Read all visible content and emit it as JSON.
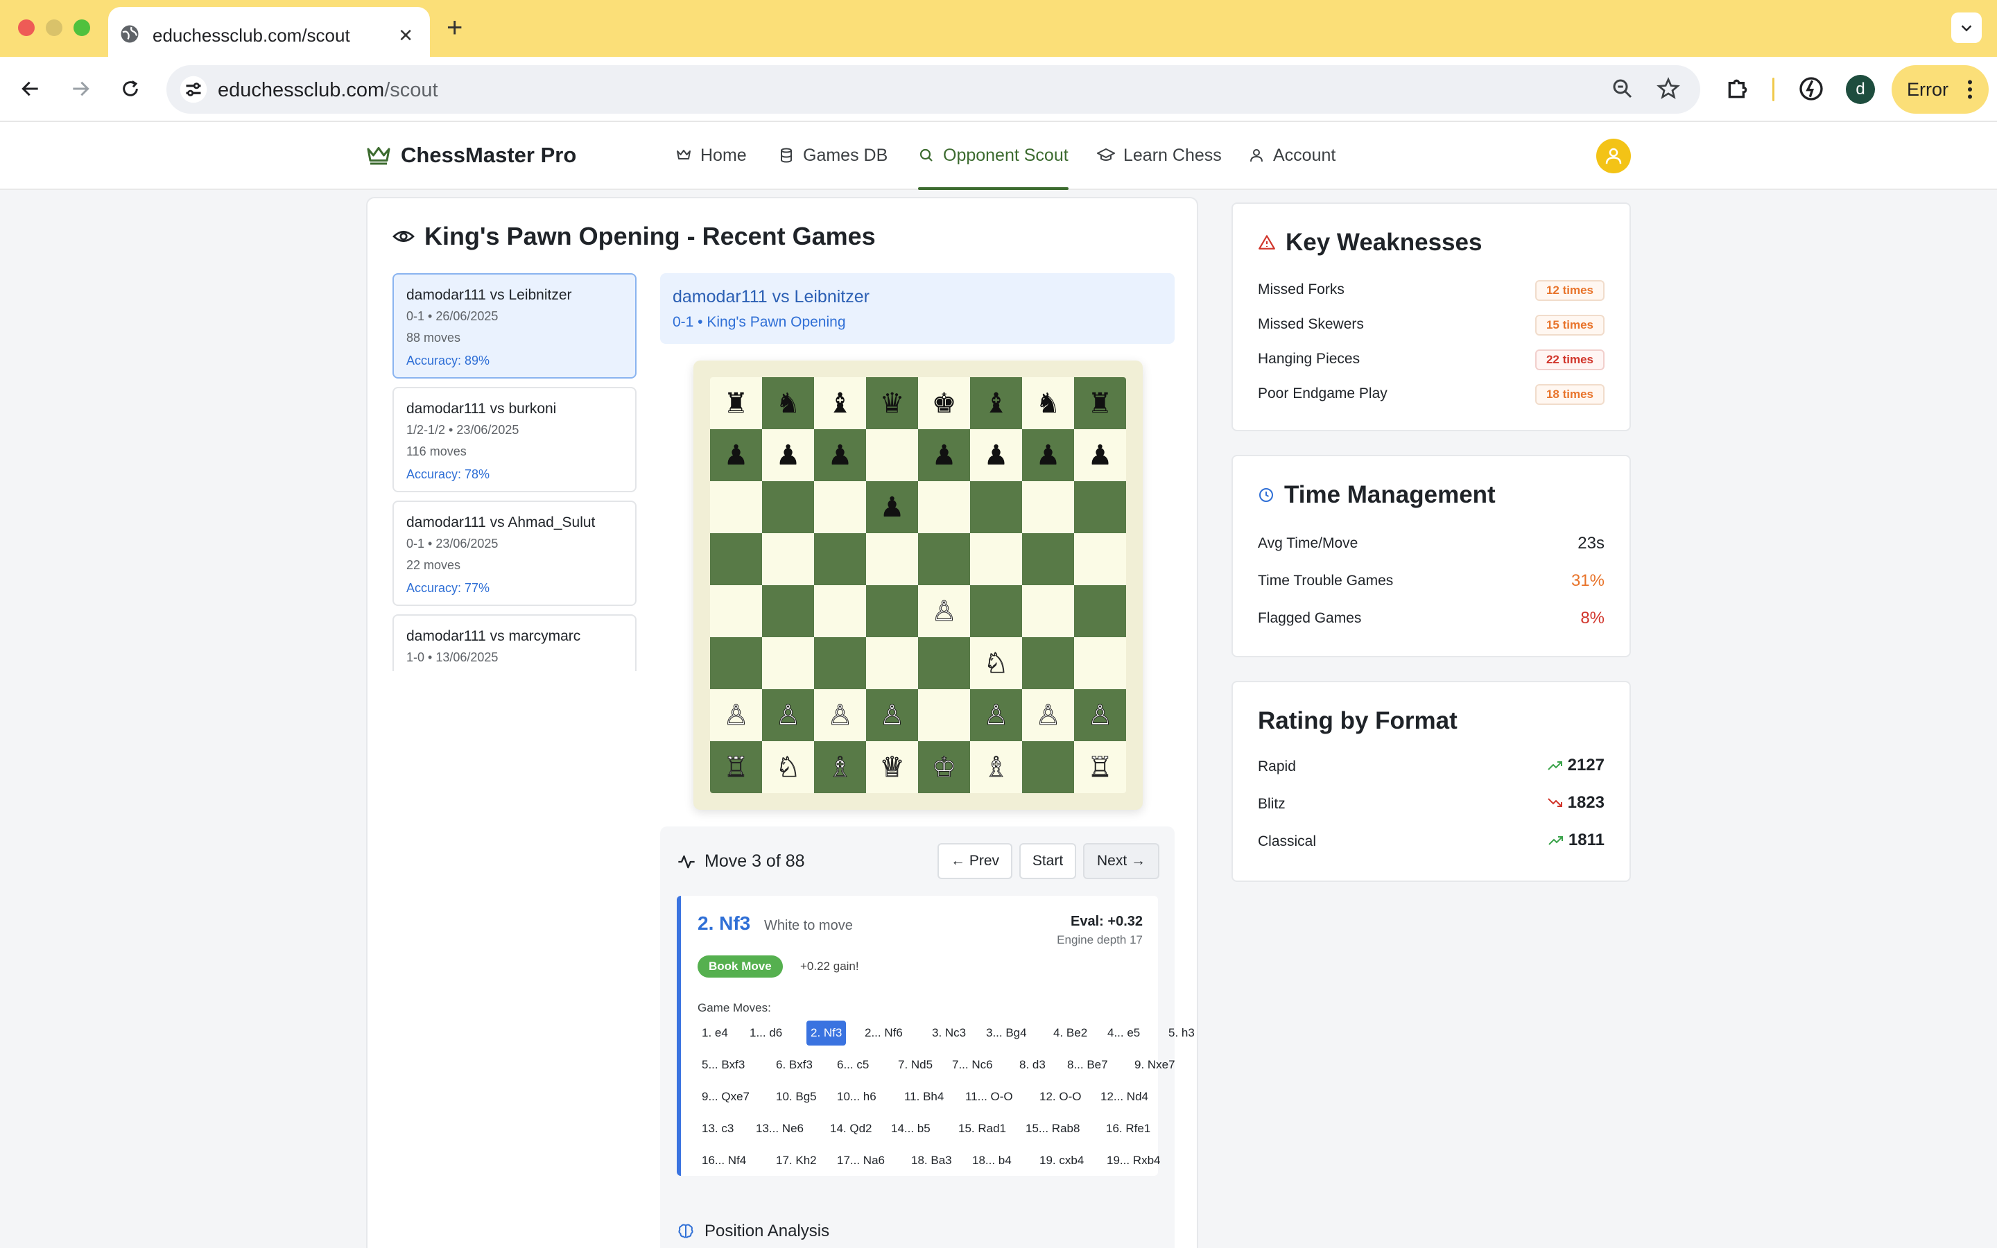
{
  "browser": {
    "tab_title": "educhessclub.com/scout",
    "url_domain": "educhessclub.com",
    "url_path": "/scout",
    "profile_initial": "d",
    "error_label": "Error"
  },
  "app": {
    "brand": "ChessMaster Pro",
    "nav": [
      {
        "label": "Home",
        "icon": "house-icon"
      },
      {
        "label": "Games DB",
        "icon": "database-icon"
      },
      {
        "label": "Opponent Scout",
        "icon": "search-icon",
        "active": true
      },
      {
        "label": "Learn Chess",
        "icon": "graduation-cap-icon"
      },
      {
        "label": "Account",
        "icon": "user-icon"
      }
    ]
  },
  "main": {
    "title": "King's Pawn Opening - Recent Games",
    "games": [
      {
        "title": "damodar111 vs Leibnitzer",
        "meta": "0-1 • 26/06/2025",
        "moves": "88 moves",
        "accuracy": "Accuracy: 89%"
      },
      {
        "title": "damodar111 vs burkoni",
        "meta": "1/2-1/2 • 23/06/2025",
        "moves": "116 moves",
        "accuracy": "Accuracy: 78%"
      },
      {
        "title": "damodar111 vs Ahmad_Sulut",
        "meta": "0-1 • 23/06/2025",
        "moves": "22 moves",
        "accuracy": "Accuracy: 77%"
      },
      {
        "title": "damodar111 vs marcymarc",
        "meta": "1-0 • 13/06/2025",
        "moves": "",
        "accuracy": ""
      }
    ],
    "selected_game": {
      "title": "damodar111 vs Leibnitzer",
      "subtitle": "0-1 • King's Pawn Opening"
    },
    "board": {
      "ranks": [
        "rnbqkbnr",
        "ppp.pppp",
        "...p....",
        "........",
        "....P...",
        ".....N..",
        "PPPP.PPP",
        "RNBQKB.R"
      ]
    },
    "move_panel": {
      "title": "Move 3 of 88",
      "prev": "← Prev",
      "start": "Start",
      "next": "Next →",
      "current_move": "2. Nf3",
      "side_to_move": "White to move",
      "eval": "Eval: +0.32",
      "depth": "Engine depth 17",
      "badge": "Book Move",
      "gain": "+0.22 gain!",
      "game_moves_label": "Game Moves:",
      "move_rows": [
        [
          "1. e4",
          "1... d6",
          "2. Nf3",
          "2... Nf6",
          "3. Nc3",
          "3... Bg4",
          "4. Be2",
          "4... e5",
          "5. h3"
        ],
        [
          "5... Bxf3",
          "6. Bxf3",
          "6... c5",
          "7. Nd5",
          "7... Nc6",
          "8. d3",
          "8... Be7",
          "9. Nxe7"
        ],
        [
          "9... Qxe7",
          "10. Bg5",
          "10... h6",
          "11. Bh4",
          "11... O-O",
          "12. O-O",
          "12... Nd4"
        ],
        [
          "13. c3",
          "13... Ne6",
          "14. Qd2",
          "14... b5",
          "15. Rad1",
          "15... Rab8",
          "16. Rfe1"
        ],
        [
          "16... Nf4",
          "17. Kh2",
          "17... Na6",
          "18. Ba3",
          "18... b4",
          "19. cxb4",
          "19... Rxb4"
        ]
      ],
      "active_move": "2. Nf3",
      "position_analysis": "Position Analysis"
    }
  },
  "weaknesses": {
    "title": "Key Weaknesses",
    "items": [
      {
        "label": "Missed Forks",
        "count": "12 times"
      },
      {
        "label": "Missed Skewers",
        "count": "15 times"
      },
      {
        "label": "Hanging Pieces",
        "count": "22 times"
      },
      {
        "label": "Poor Endgame Play",
        "count": "18 times"
      }
    ]
  },
  "time_management": {
    "title": "Time Management",
    "items": [
      {
        "label": "Avg Time/Move",
        "value": "23s"
      },
      {
        "label": "Time Trouble Games",
        "value": "31%"
      },
      {
        "label": "Flagged Games",
        "value": "8%"
      }
    ]
  },
  "ratings": {
    "title": "Rating by Format",
    "items": [
      {
        "label": "Rapid",
        "value": "2127",
        "trend": "up"
      },
      {
        "label": "Blitz",
        "value": "1823",
        "trend": "down"
      },
      {
        "label": "Classical",
        "value": "1811",
        "trend": "up"
      }
    ]
  },
  "colors": {
    "tab_bar": "#fbdf78",
    "brand_green": "#3c6b2f",
    "board_dark": "#587a47",
    "board_light": "#fbfbe6",
    "link_blue": "#2f6fd6",
    "warning_orange": "#e8742b",
    "danger_red": "#d1352b"
  }
}
